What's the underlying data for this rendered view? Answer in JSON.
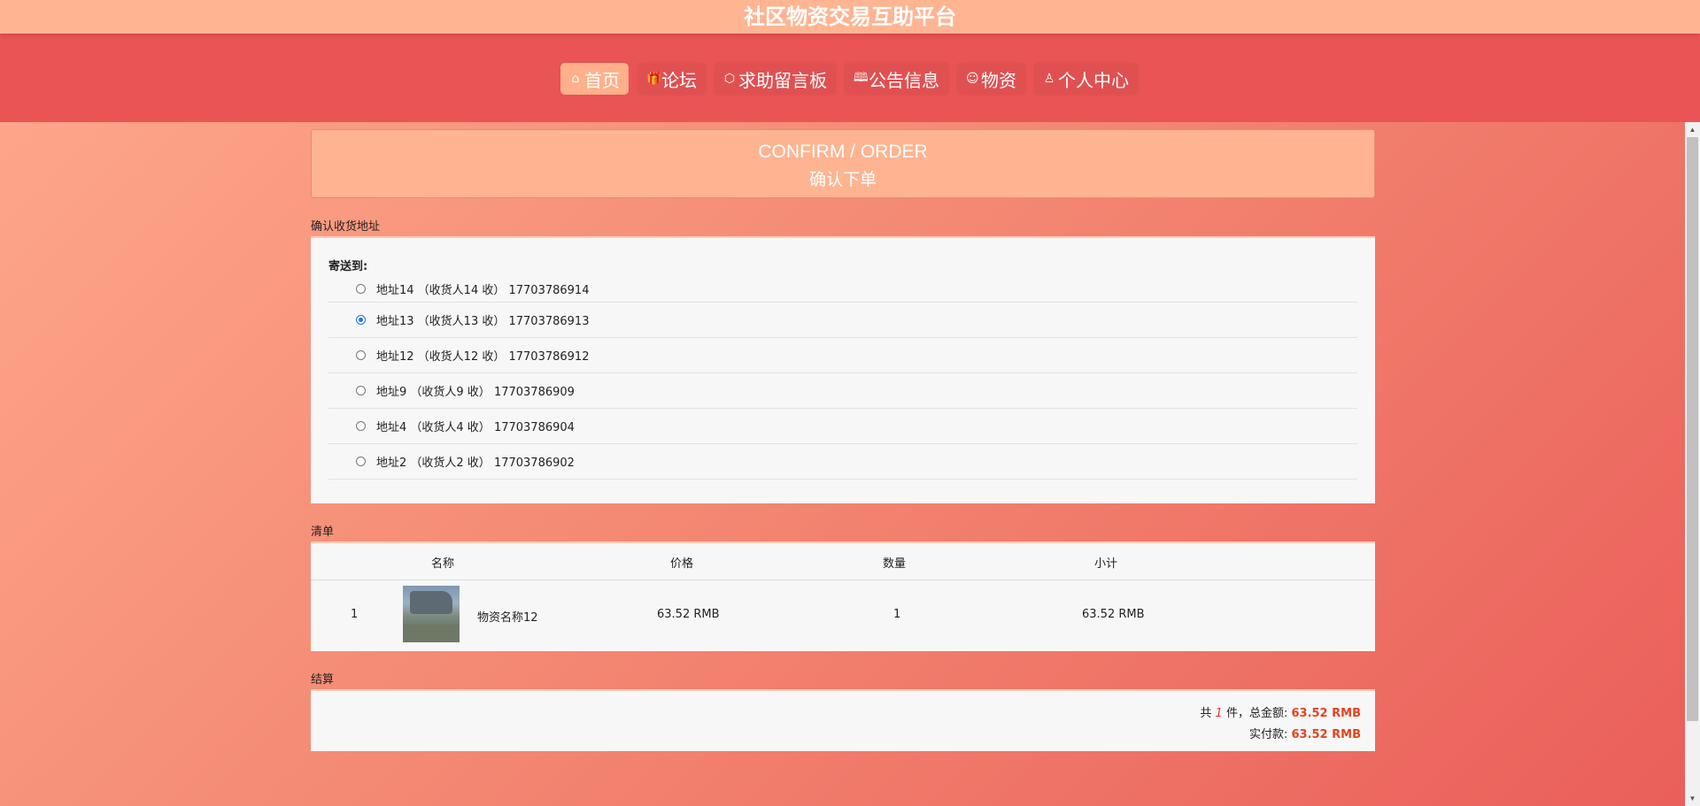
{
  "app": {
    "title": "社区物资交易互助平台"
  },
  "nav": {
    "items": [
      {
        "label": "首页",
        "icon": "home-icon",
        "glyph": "⌂",
        "active": true
      },
      {
        "label": "论坛",
        "icon": "gift-icon",
        "glyph": "🎁",
        "active": false
      },
      {
        "label": "求助留言板",
        "icon": "cube-icon",
        "glyph": "⬡",
        "active": false
      },
      {
        "label": "公告信息",
        "icon": "book-icon",
        "glyph": "🕮",
        "active": false
      },
      {
        "label": "物资",
        "icon": "smile-icon",
        "glyph": "☺",
        "active": false
      },
      {
        "label": "个人中心",
        "icon": "user-icon",
        "glyph": "♙",
        "active": false
      }
    ]
  },
  "banner": {
    "title_en": "CONFIRM / ORDER",
    "title_cn": "确认下单"
  },
  "address_section": {
    "label": "确认收货地址",
    "ship_to": "寄送到:",
    "addresses": [
      {
        "text": "地址14 （收货人14 收） 17703786914",
        "selected": false
      },
      {
        "text": "地址13 （收货人13 收） 17703786913",
        "selected": true
      },
      {
        "text": "地址12 （收货人12 收） 17703786912",
        "selected": false
      },
      {
        "text": "地址9 （收货人9 收） 17703786909",
        "selected": false
      },
      {
        "text": "地址4 （收货人4 收） 17703786904",
        "selected": false
      },
      {
        "text": "地址2 （收货人2 收） 17703786902",
        "selected": false
      }
    ]
  },
  "list_section": {
    "label": "清单",
    "headers": {
      "name": "名称",
      "price": "价格",
      "quantity": "数量",
      "subtotal": "小计"
    },
    "rows": [
      {
        "index": "1",
        "name": "物资名称12",
        "price": "63.52 RMB",
        "quantity": "1",
        "subtotal": "63.52 RMB"
      }
    ]
  },
  "checkout_section": {
    "label": "结算",
    "count_prefix": "共",
    "count": "1",
    "count_suffix": "件，总金额:",
    "total": "63.52 RMB",
    "paid_label": "实付款:",
    "paid": "63.52 RMB"
  },
  "colors": {
    "topbar": "#FFB492",
    "navbar": "#EA5455",
    "active_nav": "#FFB08A",
    "amount_red": "#E8421E"
  }
}
